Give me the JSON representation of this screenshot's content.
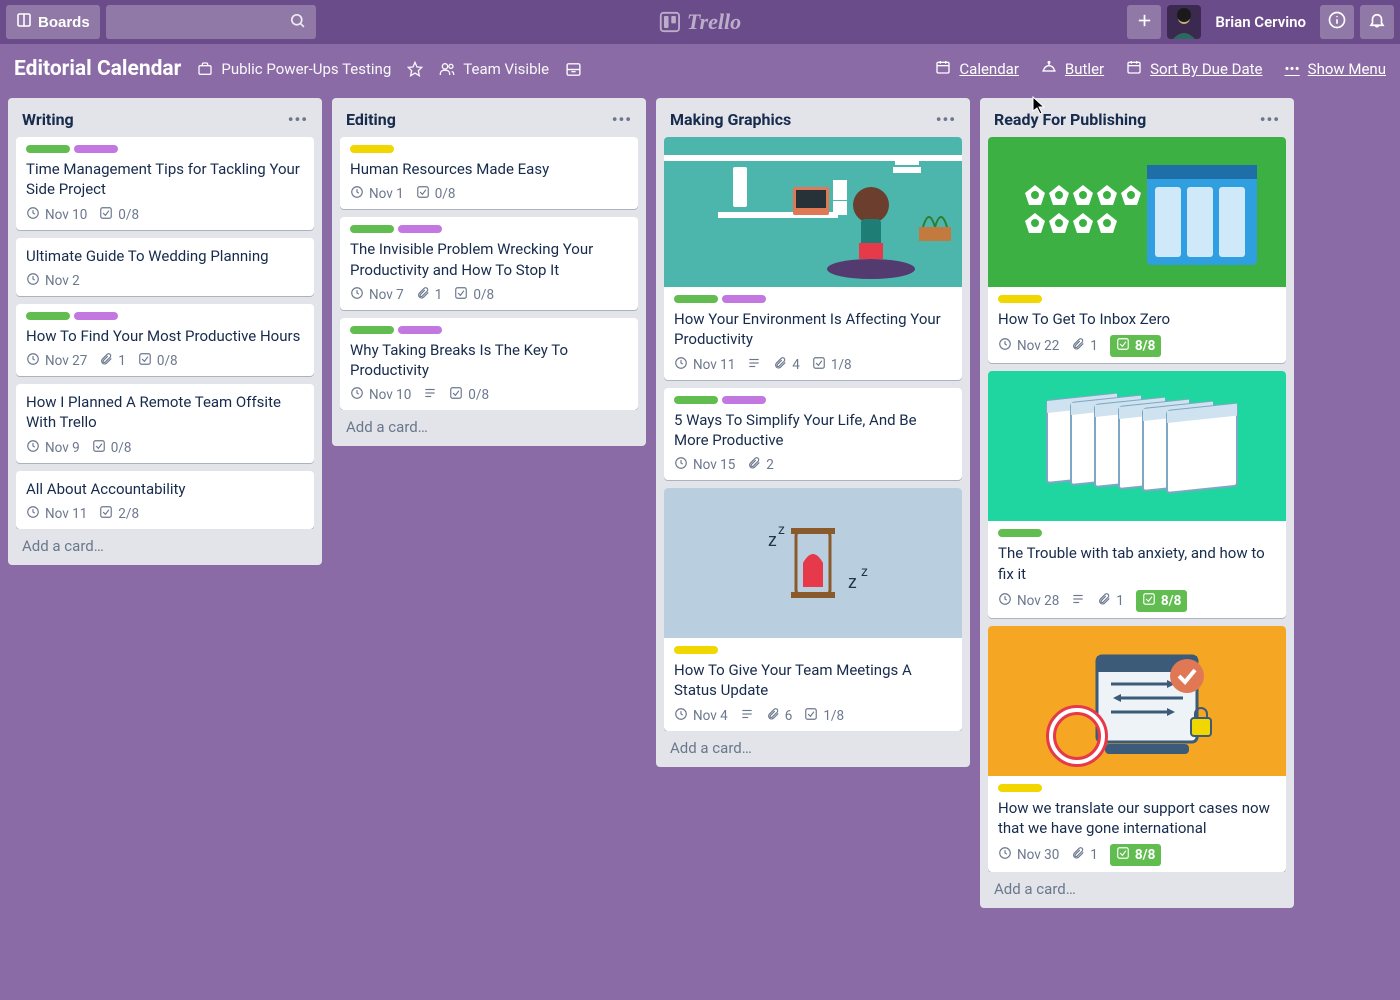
{
  "header": {
    "boards_label": "Boards",
    "app_name": "Trello",
    "username": "Brian Cervino"
  },
  "boardbar": {
    "title": "Editorial Calendar",
    "testing": "Public Power-Ups Testing",
    "team_visible": "Team Visible",
    "calendar": "Calendar",
    "butler": "Butler",
    "sort_by_due": "Sort By Due Date",
    "show_menu": "Show Menu"
  },
  "add_card_label": "Add a card…",
  "lists": [
    {
      "title": "Writing",
      "cards": [
        {
          "labels": [
            "green",
            "purple"
          ],
          "title": "Time Management Tips for Tackling Your Side Project",
          "due": "Nov 10",
          "checklist": "0/8"
        },
        {
          "labels": [],
          "title": "Ultimate Guide To Wedding Planning",
          "due": "Nov 2"
        },
        {
          "labels": [
            "green",
            "purple"
          ],
          "title": "How To Find Your Most Productive Hours",
          "due": "Nov 27",
          "attachments": 1,
          "checklist": "0/8"
        },
        {
          "labels": [],
          "title": "How I Planned A Remote Team Offsite With Trello",
          "due": "Nov 9",
          "checklist": "0/8"
        },
        {
          "labels": [],
          "title": "All About Accountability",
          "due": "Nov 11",
          "checklist": "2/8"
        }
      ]
    },
    {
      "title": "Editing",
      "cards": [
        {
          "labels": [
            "yellow"
          ],
          "title": "Human Resources Made Easy",
          "due": "Nov 1",
          "checklist": "0/8"
        },
        {
          "labels": [
            "green",
            "purple"
          ],
          "title": "The Invisible Problem Wrecking Your Productivity and How To Stop It",
          "due": "Nov 7",
          "attachments": 1,
          "checklist": "0/8"
        },
        {
          "labels": [
            "green",
            "purple"
          ],
          "title": "Why Taking Breaks Is The Key To Productivity",
          "due": "Nov 10",
          "description": true,
          "checklist": "0/8"
        }
      ]
    },
    {
      "title": "Making Graphics",
      "cards": [
        {
          "labels": [
            "green",
            "purple"
          ],
          "title": "How Your Environment Is Affecting Your Productivity",
          "due": "Nov 11",
          "description": true,
          "attachments": 4,
          "checklist": "1/8",
          "cover": "teal"
        },
        {
          "labels": [
            "green",
            "purple"
          ],
          "title": "5 Ways To Simplify Your Life, And Be More Productive",
          "due": "Nov 15",
          "attachments": 2
        },
        {
          "labels": [
            "yellow"
          ],
          "title": "How To Give Your Team Meetings A Status Update",
          "due": "Nov 4",
          "description": true,
          "attachments": 6,
          "checklist": "1/8",
          "cover": "lightblue"
        }
      ]
    },
    {
      "title": "Ready For Publishing",
      "cards": [
        {
          "labels": [
            "yellow"
          ],
          "title": "How To Get To Inbox Zero",
          "due": "Nov 22",
          "attachments": 1,
          "checklist": "8/8",
          "checklist_done": true,
          "cover": "green"
        },
        {
          "labels": [
            "green"
          ],
          "title": "The Trouble with tab anxiety, and how to fix it",
          "due": "Nov 28",
          "description": true,
          "attachments": 1,
          "checklist": "8/8",
          "checklist_done": true,
          "cover": "mint"
        },
        {
          "labels": [
            "yellow"
          ],
          "title": "How we translate our support cases now that we have gone international",
          "due": "Nov 30",
          "attachments": 1,
          "checklist": "8/8",
          "checklist_done": true,
          "cover": "orange"
        }
      ]
    }
  ]
}
